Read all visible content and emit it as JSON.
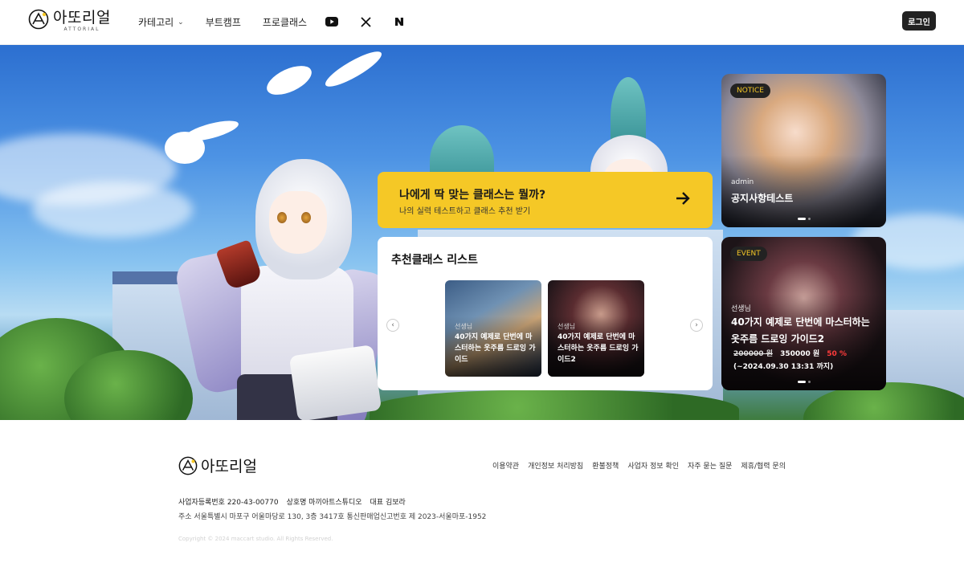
{
  "header": {
    "logo_text": "아또리얼",
    "logo_sub": "ATTORIAL",
    "nav": [
      {
        "label": "카테고리",
        "has_dropdown": true
      },
      {
        "label": "부트캠프"
      },
      {
        "label": "프로클래스"
      }
    ],
    "social_icons": [
      "youtube-icon",
      "x-icon",
      "naver-icon"
    ],
    "login_label": "로그인"
  },
  "test_banner": {
    "title": "나에게 딱 맞는 클래스는 뭘까?",
    "subtitle": "나의 실력 테스트하고 클래스 추천 받기",
    "accent": "#f5c826"
  },
  "recommended": {
    "title": "추천클래스 리스트",
    "cards": [
      {
        "teacher": "선생님",
        "title": "40가지 예제로 단번에 마스터하는 옷주름 드로잉 가이드"
      },
      {
        "teacher": "선생님",
        "title": "40가지 예제로 단번에 마스터하는 옷주름 드로잉 가이드2"
      }
    ]
  },
  "notice_card": {
    "badge": "NOTICE",
    "author": "admin",
    "title": "공지사항테스트"
  },
  "event_card": {
    "badge": "EVENT",
    "teacher": "선생님",
    "title": "40가지 예제로 단번에 마스터하는 옷주름 드로잉 가이드2",
    "original_price": "200000 원",
    "sale_price": "350000 원",
    "discount": "50 %",
    "until": "(~2024.09.30 13:31 까지)"
  },
  "footer": {
    "logo_text": "아또리얼",
    "links": [
      "이용약관",
      "개인정보 처리방침",
      "환불정책",
      "사업자 정보 확인",
      "자주 묻는 질문",
      "제휴/협력 문의"
    ],
    "business_number": "사업자등록번호 220-43-00770",
    "company_name": "상호명 마끼아트스튜디오",
    "ceo": "대표 김보라",
    "address": "주소 서울특별시 마포구 어울마당로 130, 3층 3417호 통신판매업신고번호 제 2023-서울마포-1952",
    "copyright": "Copyright © 2024 maccart studio. All Rights Reserved."
  }
}
